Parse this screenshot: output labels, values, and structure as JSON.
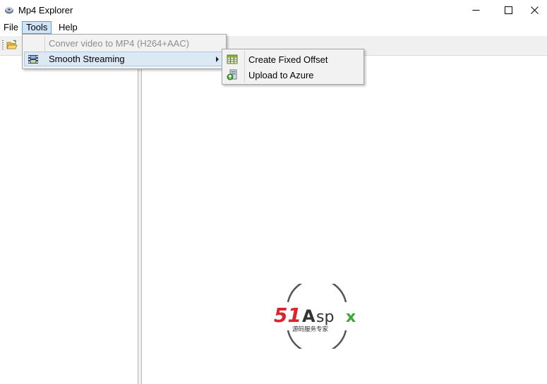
{
  "window": {
    "title": "Mp4 Explorer"
  },
  "menubar": {
    "items": [
      "File",
      "Tools",
      "Help"
    ]
  },
  "tools_menu": {
    "items": [
      {
        "label": "Conver video to MP4 (H264+AAC)",
        "enabled": false
      },
      {
        "label": "Smooth Streaming",
        "has_submenu": true,
        "icon": "film-icon"
      }
    ]
  },
  "smooth_streaming_menu": {
    "items": [
      {
        "label": "Create Fixed Offset",
        "icon": "grid-table-icon"
      },
      {
        "label": "Upload to Azure",
        "icon": "upload-cloud-icon"
      }
    ]
  },
  "watermark": {
    "brand": "51Aspx",
    "tagline": "源码服务专家"
  },
  "colors": {
    "menu_highlight": "#cfe4f7",
    "menu_highlight_border": "#5fa0d8",
    "watermark_red": "#d9262c",
    "watermark_green": "#39a935"
  }
}
